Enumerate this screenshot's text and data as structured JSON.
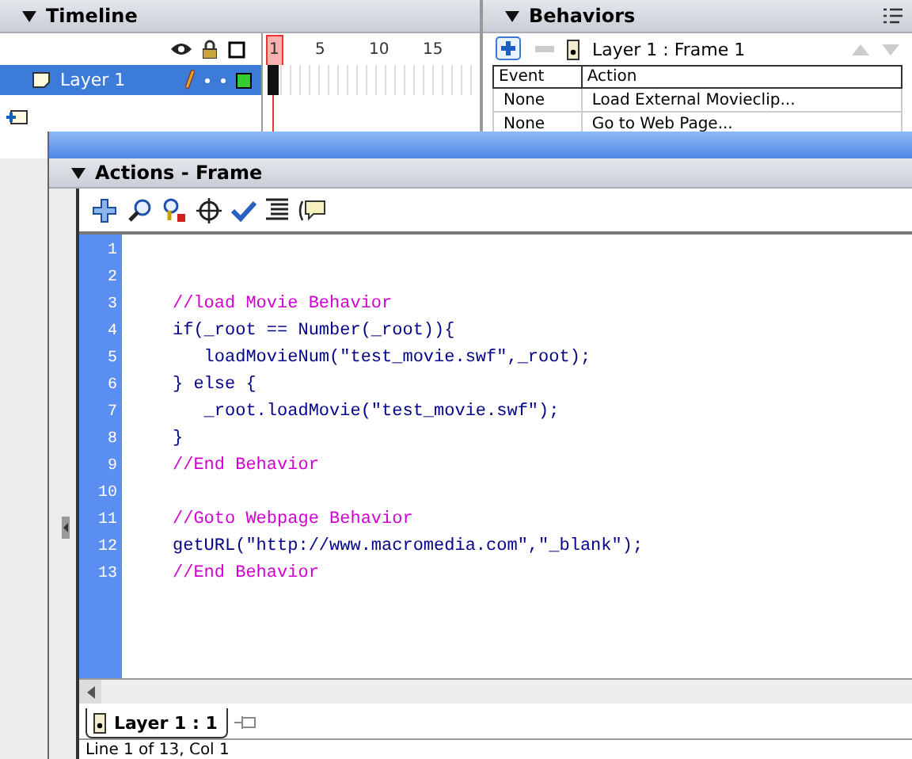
{
  "timeline": {
    "title": "Timeline",
    "frame_numbers": [
      "1",
      "5",
      "10",
      "15"
    ],
    "layers": [
      {
        "name": "Layer 1",
        "selected": true
      }
    ]
  },
  "behaviors": {
    "title": "Behaviors",
    "target": "Layer 1 : Frame 1",
    "columns": [
      "Event",
      "Action"
    ],
    "rows": [
      {
        "event": "None",
        "action": "Load External Movieclip..."
      },
      {
        "event": "None",
        "action": "Go to Web Page..."
      }
    ]
  },
  "actions": {
    "title": "Actions - Frame",
    "lines": [
      {
        "number": "1",
        "kind": "blank"
      },
      {
        "number": "2",
        "kind": "blank"
      },
      {
        "number": "3",
        "kind": "comment",
        "text": "//load Movie Behavior"
      },
      {
        "number": "4",
        "kind": "code",
        "text": "if(_root == Number(_root)){"
      },
      {
        "number": "5",
        "kind": "code",
        "text": "   loadMovieNum(\"test_movie.swf\",_root);"
      },
      {
        "number": "6",
        "kind": "code",
        "text": "} else {"
      },
      {
        "number": "7",
        "kind": "code",
        "text": "   _root.loadMovie(\"test_movie.swf\");"
      },
      {
        "number": "8",
        "kind": "code",
        "text": "}"
      },
      {
        "number": "9",
        "kind": "comment",
        "text": "//End Behavior"
      },
      {
        "number": "10",
        "kind": "blank"
      },
      {
        "number": "11",
        "kind": "comment",
        "text": "//Goto Webpage Behavior"
      },
      {
        "number": "12",
        "kind": "code",
        "text": "getURL(\"http://www.macromedia.com\",\"_blank\");"
      },
      {
        "number": "13",
        "kind": "comment",
        "text": "//End Behavior"
      }
    ],
    "tab": "Layer 1 : 1",
    "status": "Line 1 of 13, Col 1"
  }
}
